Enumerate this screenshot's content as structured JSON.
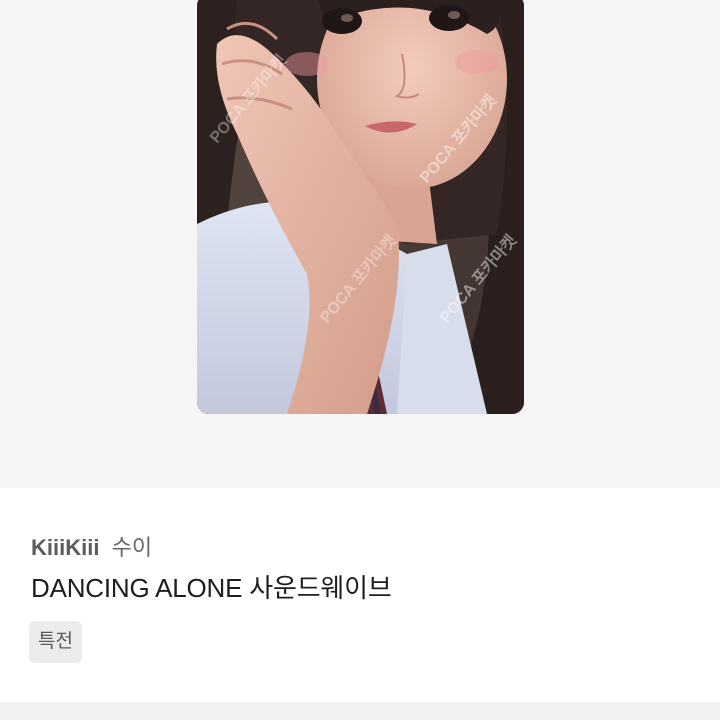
{
  "product": {
    "image_alt": "photocard",
    "watermark": "POCA 포카마켓",
    "artist": "KiiiKiii",
    "member": "수이",
    "title": "DANCING ALONE 사운드웨이브",
    "tag": "특전"
  },
  "colors": {
    "page_bg": "#ffffff",
    "hero_bg": "#f5f5f5",
    "tag_bg": "#ececec",
    "title_text": "#1e1e1e",
    "artist_text": "#5b5b5b"
  }
}
